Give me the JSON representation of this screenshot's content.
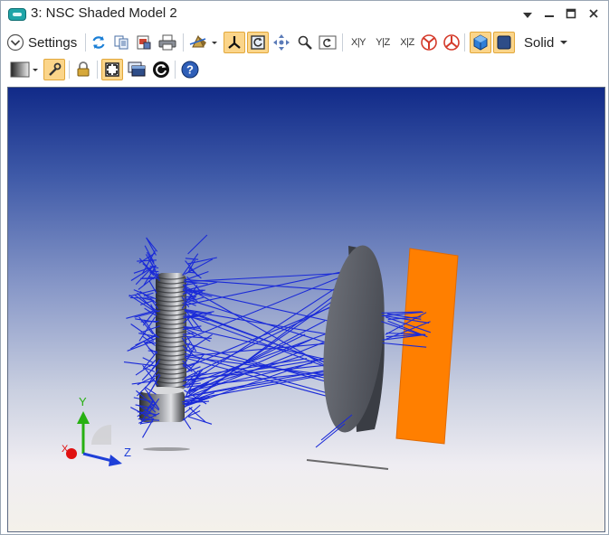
{
  "window": {
    "title": "3: NSC Shaded Model 2",
    "controls": [
      "dropdown",
      "minimize",
      "maximize",
      "close"
    ]
  },
  "toolbar": {
    "settings_label": "Settings",
    "solid_label": "Solid",
    "view_xy_label": "X|Y",
    "view_yz_label": "Y|Z",
    "view_xz_label": "X|Z"
  },
  "viewport": {
    "axes": {
      "x_label": "X",
      "y_label": "Y",
      "z_label": "Z"
    },
    "colors": {
      "background_top": "#112a88",
      "background_bottom": "#f4f1ea",
      "rays": "#1a2ad8",
      "detector": "#ff7f00",
      "lens": "#5b5e66",
      "axis_x": "#e01010",
      "axis_y": "#27b012",
      "axis_z": "#1e3fd8"
    }
  }
}
